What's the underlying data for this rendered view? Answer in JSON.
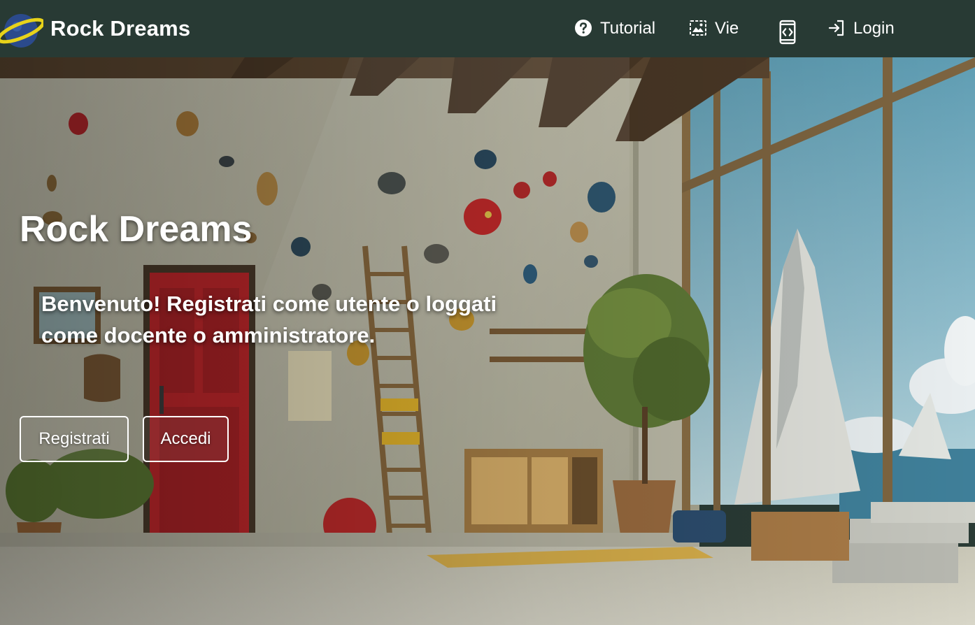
{
  "app": {
    "brand_name": "Rock Dreams",
    "logo_icon": "planet-icon"
  },
  "nav": {
    "items": [
      {
        "label": "Tutorial",
        "icon": "help-circle-icon"
      },
      {
        "label": "Vie",
        "icon": "image-gallery-icon"
      },
      {
        "label": "",
        "icon": "device-switch-icon"
      },
      {
        "label": "Login",
        "icon": "login-icon"
      }
    ]
  },
  "hero": {
    "title": "Rock Dreams",
    "text": "Benvenuto! Registrati come utente o loggati come docente o amministratore.",
    "register_label": "Registrati",
    "login_label": "Accedi",
    "background": "climbing-gym-illustration"
  },
  "colors": {
    "navbar": "#283a34",
    "text": "#ffffff",
    "accent_planet": "#2b4a8c",
    "accent_ring": "#e7d21a"
  }
}
